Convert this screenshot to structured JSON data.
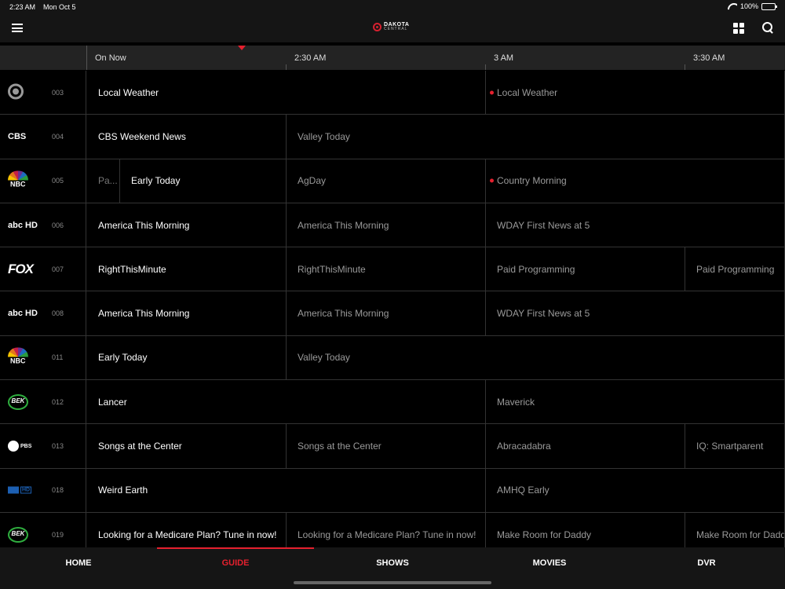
{
  "status_bar": {
    "time": "2:23 AM",
    "date": "Mon Oct 5",
    "battery": "100%"
  },
  "header": {
    "logo_line1": "DAKOTA",
    "logo_line2": "CENTRAL",
    "brand_color": "#d6202f"
  },
  "timeline": {
    "slots": [
      "On Now",
      "2:30 AM",
      "3 AM",
      "3:30 AM"
    ]
  },
  "channels": [
    {
      "number": "003",
      "logo": "weather-icon",
      "programs": [
        {
          "title": "Local Weather",
          "state": "cur"
        },
        {
          "title": "Local Weather",
          "state": "fut",
          "rec": true
        }
      ]
    },
    {
      "number": "004",
      "logo": "cbs-logo",
      "logo_text": "CBS",
      "programs": [
        {
          "title": "CBS Weekend News",
          "state": "cur"
        },
        {
          "title": "Valley Today",
          "state": "fut"
        }
      ]
    },
    {
      "number": "005",
      "logo": "nbc-logo",
      "logo_text": "NBC",
      "programs": [
        {
          "title": "Pa...",
          "state": "past"
        },
        {
          "title": "Early Today",
          "state": "cur"
        },
        {
          "title": "AgDay",
          "state": "fut"
        },
        {
          "title": "Country Morning",
          "state": "fut",
          "rec": true
        }
      ]
    },
    {
      "number": "006",
      "logo": "abc-hd-logo",
      "logo_text": "abc HD",
      "programs": [
        {
          "title": "America This Morning",
          "state": "cur"
        },
        {
          "title": "America This Morning",
          "state": "fut"
        },
        {
          "title": "WDAY First News at 5",
          "state": "fut"
        }
      ]
    },
    {
      "number": "007",
      "logo": "fox-logo",
      "logo_text": "FOX",
      "programs": [
        {
          "title": "RightThisMinute",
          "state": "cur"
        },
        {
          "title": "RightThisMinute",
          "state": "fut"
        },
        {
          "title": "Paid Programming",
          "state": "fut"
        },
        {
          "title": "Paid Programming",
          "state": "fut"
        }
      ]
    },
    {
      "number": "008",
      "logo": "abc-hd-logo",
      "logo_text": "abc HD",
      "programs": [
        {
          "title": "America This Morning",
          "state": "cur"
        },
        {
          "title": "America This Morning",
          "state": "fut"
        },
        {
          "title": "WDAY First News at 5",
          "state": "fut"
        }
      ]
    },
    {
      "number": "011",
      "logo": "nbc-logo",
      "logo_text": "NBC",
      "programs": [
        {
          "title": "Early Today",
          "state": "cur"
        },
        {
          "title": "Valley Today",
          "state": "fut"
        }
      ]
    },
    {
      "number": "012",
      "logo": "bek-logo",
      "logo_text": "BEK",
      "programs": [
        {
          "title": "Lancer",
          "state": "cur"
        },
        {
          "title": "Maverick",
          "state": "fut"
        }
      ]
    },
    {
      "number": "013",
      "logo": "pbs-logo",
      "logo_text": "PBS",
      "programs": [
        {
          "title": "Songs at the Center",
          "state": "cur"
        },
        {
          "title": "Songs at the Center",
          "state": "fut"
        },
        {
          "title": "Abracadabra",
          "state": "fut"
        },
        {
          "title": "IQ: Smartparent",
          "state": "fut"
        }
      ]
    },
    {
      "number": "018",
      "logo": "amhq-logo",
      "logo_text": "HD",
      "programs": [
        {
          "title": "Weird Earth",
          "state": "cur"
        },
        {
          "title": "AMHQ Early",
          "state": "fut"
        }
      ]
    },
    {
      "number": "019",
      "logo": "bek-logo",
      "logo_text": "BEK",
      "programs": [
        {
          "title": "Looking for a Medicare Plan? Tune in now!",
          "state": "cur"
        },
        {
          "title": "Looking for a Medicare Plan? Tune in now!",
          "state": "fut"
        },
        {
          "title": "Make Room for Daddy",
          "state": "fut"
        },
        {
          "title": "Make Room for Daddy",
          "state": "fut"
        }
      ]
    }
  ],
  "tabs": [
    {
      "label": "HOME"
    },
    {
      "label": "GUIDE",
      "active": true
    },
    {
      "label": "SHOWS"
    },
    {
      "label": "MOVIES"
    },
    {
      "label": "DVR"
    }
  ],
  "colors": {
    "accent": "#e5202e",
    "background": "#000000",
    "bar": "#151515"
  }
}
